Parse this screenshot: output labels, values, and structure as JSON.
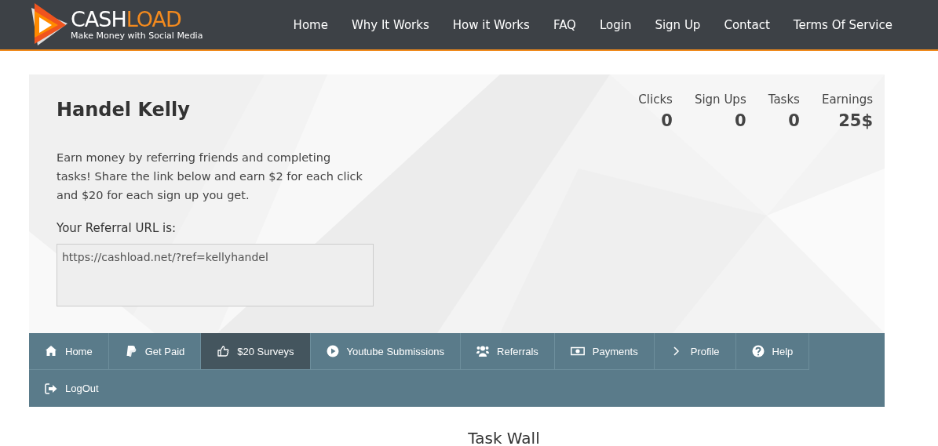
{
  "header": {
    "logo": {
      "brand_first": "CASH",
      "brand_second": "LOAD",
      "tagline": "Make Money with Social Media"
    },
    "menu": [
      {
        "label": "Home"
      },
      {
        "label": "Why It Works"
      },
      {
        "label": "How it Works"
      },
      {
        "label": "FAQ"
      },
      {
        "label": "Login"
      },
      {
        "label": "Sign Up"
      },
      {
        "label": "Contact"
      },
      {
        "label": "Terms Of Service"
      }
    ]
  },
  "profile": {
    "name": "Handel Kelly",
    "description": "Earn money by referring friends and completing tasks! Share the link below and earn $2 for each click and $20 for each sign up you get.",
    "referral_label": "Your Referral URL is:",
    "referral_url": "https://cashload.net/?ref=kellyhandel",
    "stats": [
      {
        "label": "Clicks",
        "value": "0"
      },
      {
        "label": "Sign Ups",
        "value": "0"
      },
      {
        "label": "Tasks",
        "value": "0"
      },
      {
        "label": "Earnings",
        "value": "25$"
      }
    ]
  },
  "tabs": [
    {
      "label": "Home",
      "selected": false
    },
    {
      "label": "Get Paid",
      "selected": false
    },
    {
      "label": "$20 Surveys",
      "selected": true
    },
    {
      "label": "Youtube Submissions",
      "selected": false
    },
    {
      "label": "Referrals",
      "selected": false
    },
    {
      "label": "Payments",
      "selected": false
    },
    {
      "label": "Profile",
      "selected": false
    },
    {
      "label": "Help",
      "selected": false
    },
    {
      "label": "LogOut",
      "selected": false
    }
  ],
  "section_title": "Task Wall"
}
